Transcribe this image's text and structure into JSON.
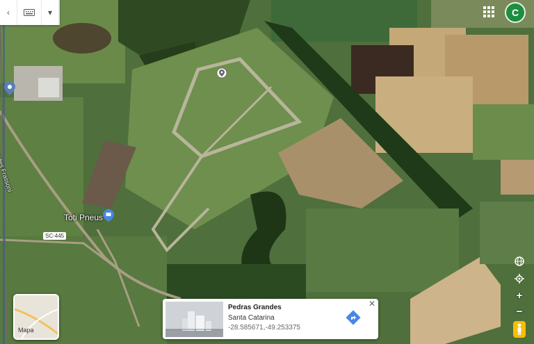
{
  "topbar": {
    "back_icon": "chevron-left-icon",
    "keyboard_icon": "keyboard-icon",
    "menu_icon": "caret-down-icon"
  },
  "account": {
    "initial": "C",
    "color": "#1e8e3e"
  },
  "labels": {
    "street": "R. Aristides Frassoni",
    "road": "SC-445",
    "place": "Toti Pneus"
  },
  "minimap": {
    "label": "Mapa"
  },
  "controls": {
    "globe_icon": "globe-icon",
    "locate_icon": "my-location-icon",
    "zoom_in": "+",
    "zoom_out": "−",
    "pegman_icon": "pegman-icon"
  },
  "card": {
    "title": "Pedras Grandes",
    "subtitle": "Santa Catarina",
    "coords": "-28.585671,-49.253375",
    "close": "✕",
    "directions_icon": "directions-icon"
  }
}
